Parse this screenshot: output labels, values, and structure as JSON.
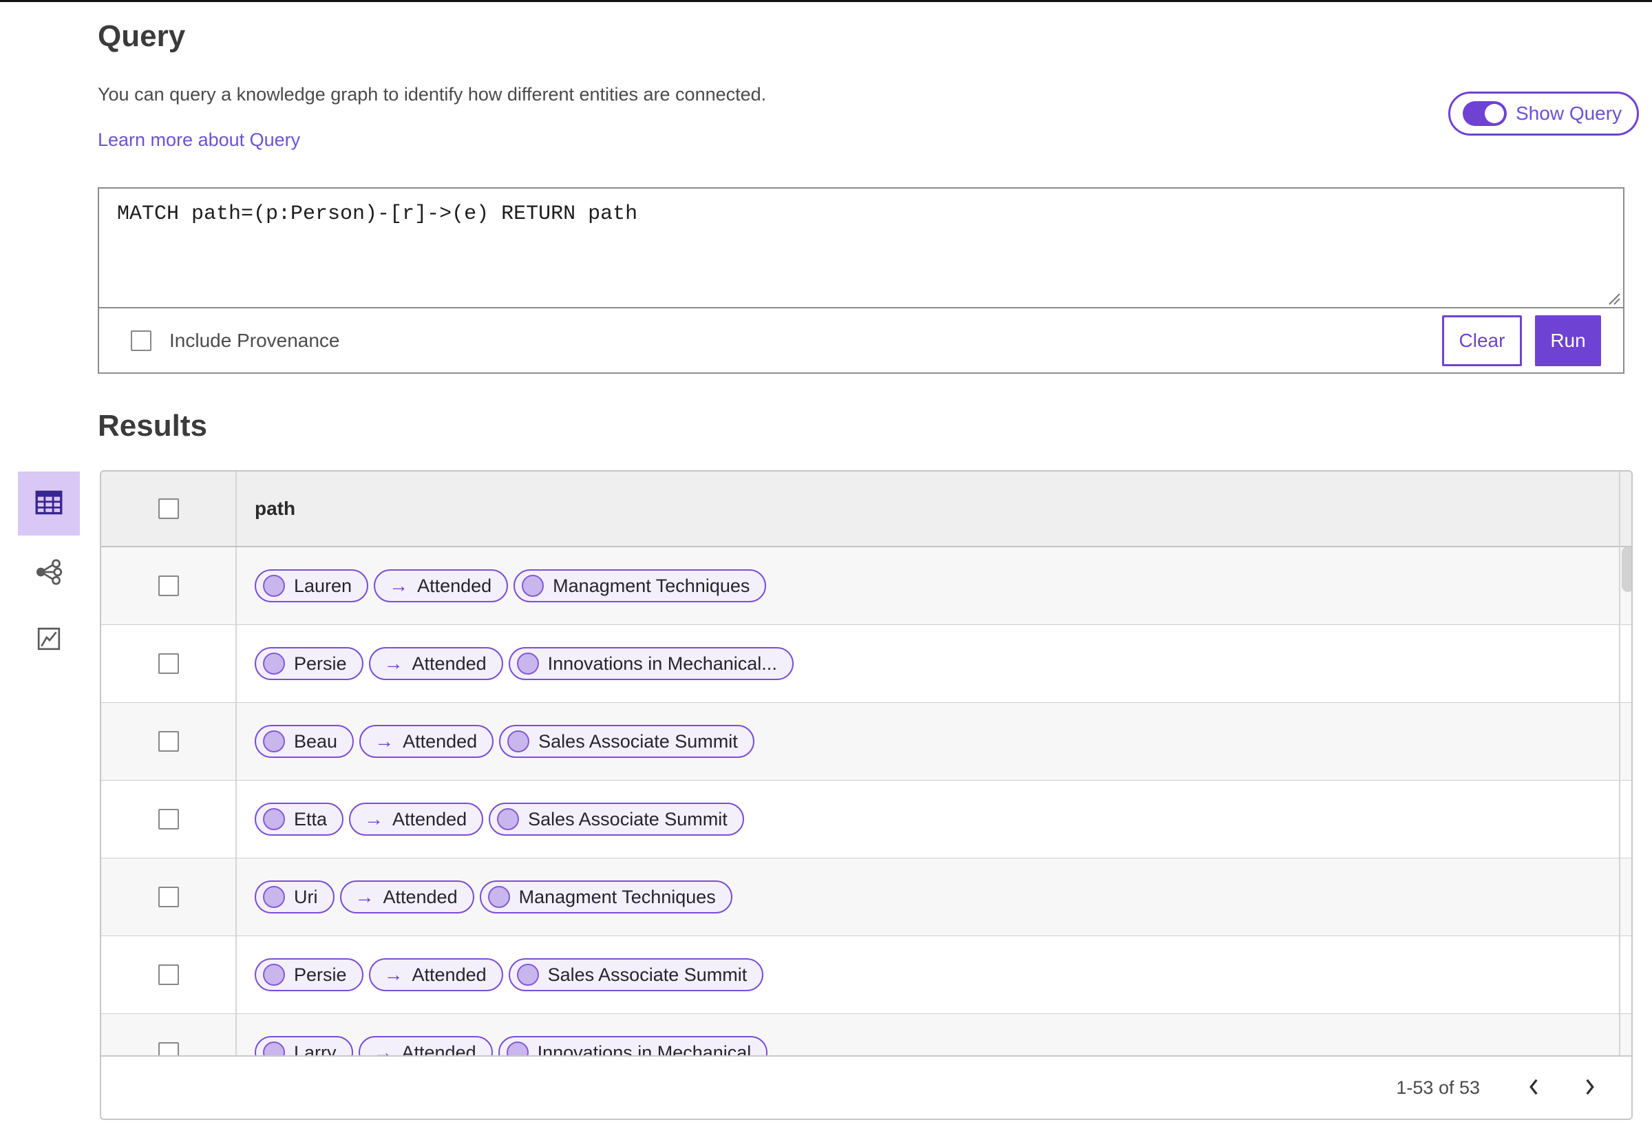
{
  "colors": {
    "accent_purple": "#6e42d3",
    "chip_border": "#7b4ed6",
    "chip_background": "#f3f0fb",
    "node_fill": "#c9b6ec",
    "node_border": "#8459d8",
    "selected_view_background": "#d9c7f6",
    "link": "#6a52d6"
  },
  "query": {
    "title": "Query",
    "description": "You can query a knowledge graph to identify how different entities are connected.",
    "learn_more_link": "Learn more about Query",
    "show_query_toggle": {
      "label": "Show Query",
      "state": "on"
    },
    "editor_text": "MATCH path=(p:Person)-[r]->(e) RETURN path",
    "include_provenance": {
      "label": "Include Provenance",
      "checked": false
    },
    "buttons": {
      "clear": "Clear",
      "run": "Run"
    }
  },
  "results": {
    "title": "Results",
    "views": [
      {
        "name": "table-view",
        "icon": "table-icon",
        "selected": true
      },
      {
        "name": "graph-view",
        "icon": "network-graph-icon",
        "selected": false
      },
      {
        "name": "chart-view",
        "icon": "line-chart-icon",
        "selected": false
      }
    ],
    "table": {
      "column_header": "path",
      "select_all_checked": false,
      "arrow_symbol": "→",
      "rows": [
        {
          "source": "Lauren",
          "relation": "Attended",
          "target": "Managment Techniques"
        },
        {
          "source": "Persie",
          "relation": "Attended",
          "target": "Innovations in Mechanical..."
        },
        {
          "source": "Beau",
          "relation": "Attended",
          "target": "Sales Associate Summit"
        },
        {
          "source": "Etta",
          "relation": "Attended",
          "target": "Sales Associate Summit"
        },
        {
          "source": "Uri",
          "relation": "Attended",
          "target": "Managment Techniques"
        },
        {
          "source": "Persie",
          "relation": "Attended",
          "target": "Sales Associate Summit"
        },
        {
          "source": "Larry",
          "relation": "Attended",
          "target": "Innovations in Mechanical"
        }
      ]
    },
    "pagination": {
      "range_label": "1-53 of 53",
      "prev_icon": "chevron-left-icon",
      "next_icon": "chevron-right-icon"
    }
  }
}
